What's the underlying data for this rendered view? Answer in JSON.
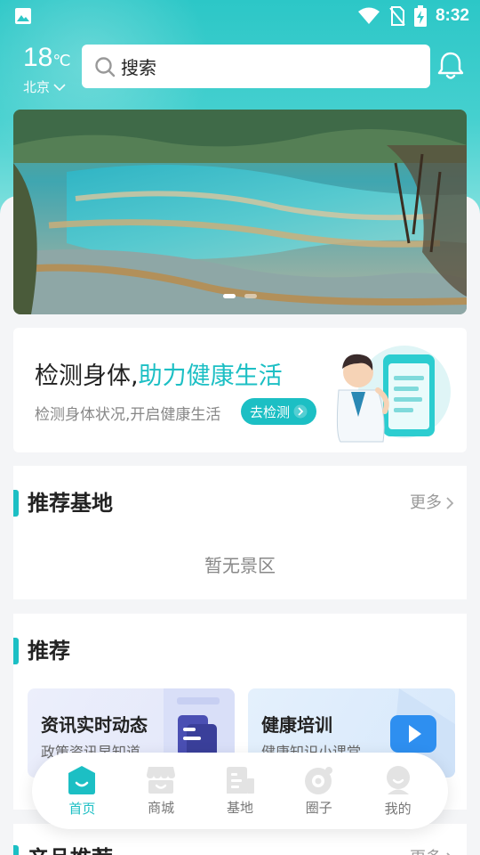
{
  "status_bar": {
    "time": "8:32"
  },
  "weather": {
    "temp": "18",
    "unit": "℃",
    "city": "北京"
  },
  "search": {
    "placeholder": "搜索"
  },
  "banner": {
    "slides": 2,
    "active_index": 0
  },
  "detect_card": {
    "title_plain": "检测身体,",
    "title_highlight": "助力健康生活",
    "subtitle": "检测身体状况,开启健康生活",
    "button_label": "去检测"
  },
  "recommended_bases": {
    "title": "推荐基地",
    "more_label": "更多",
    "empty_text": "暂无景区"
  },
  "recommend": {
    "title": "推荐",
    "cards": [
      {
        "title": "资讯实时动态",
        "subtitle": "政策资讯早知道"
      },
      {
        "title": "健康培训",
        "subtitle": "健康知识小课堂"
      }
    ]
  },
  "product_recommend": {
    "title": "产品推荐",
    "more_label": "更多"
  },
  "bottom_nav": {
    "items": [
      {
        "label": "首页",
        "icon": "home-icon",
        "active": true
      },
      {
        "label": "商城",
        "icon": "store-icon",
        "active": false
      },
      {
        "label": "基地",
        "icon": "building-icon",
        "active": false
      },
      {
        "label": "圈子",
        "icon": "circle-camera-icon",
        "active": false
      },
      {
        "label": "我的",
        "icon": "profile-icon",
        "active": false
      }
    ]
  },
  "colors": {
    "accent": "#1cbfc4",
    "header": "#2cc7c7"
  }
}
